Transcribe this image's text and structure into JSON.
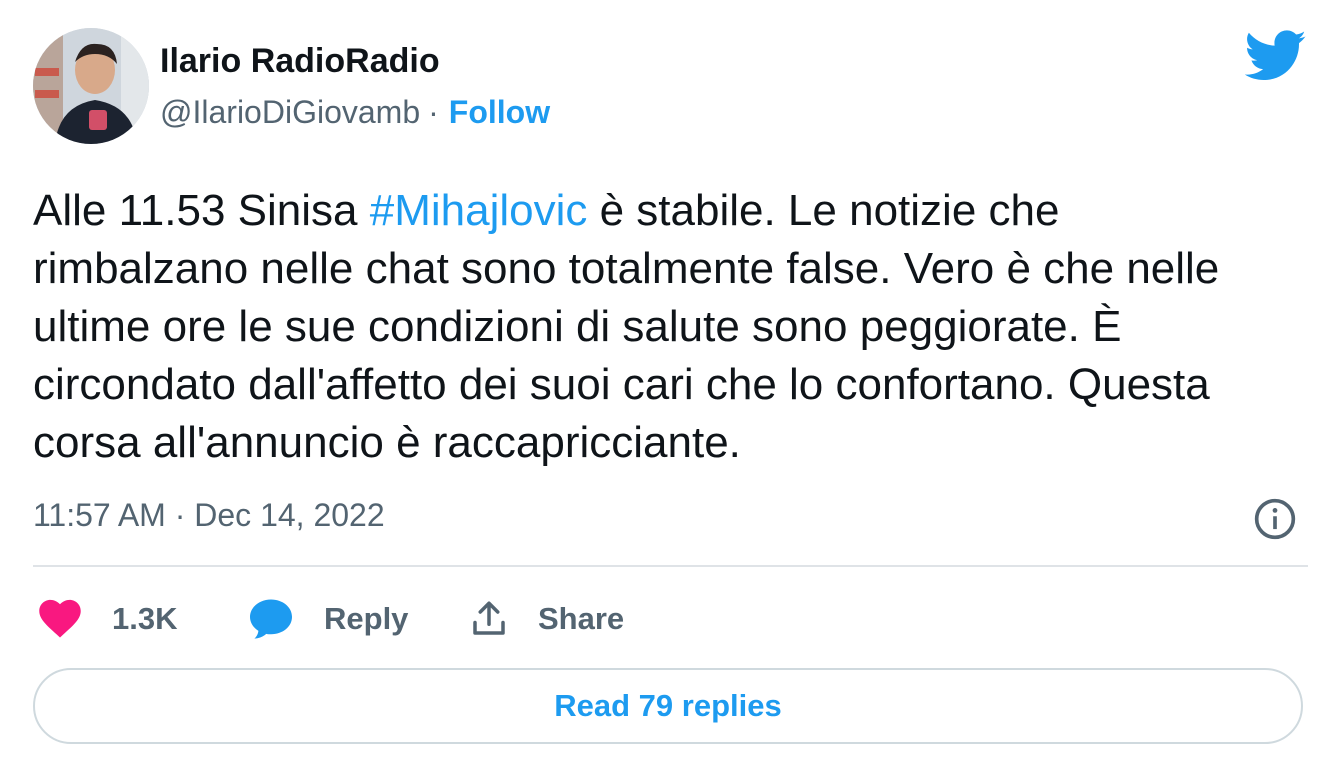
{
  "author": {
    "display_name": "Ilario RadioRadio",
    "handle": "@IlarioDiGiovamb",
    "separator": "·",
    "follow_label": "Follow"
  },
  "tweet": {
    "text_before_hashtag": "Alle 11.53 Sinisa ",
    "hashtag": "#Mihajlovic",
    "text_after_hashtag": " è stabile. Le notizie che rimbalzano nelle chat sono totalmente false. Vero è che nelle ultime ore le sue condizioni di salute sono peggiorate. È circondato dall'affetto dei suoi cari che lo confortano. Questa corsa all'annuncio è raccapricciante.",
    "timestamp": "11:57 AM · Dec 14, 2022"
  },
  "actions": {
    "like_count": "1.3K",
    "reply_label": "Reply",
    "share_label": "Share",
    "read_replies_label": "Read 79 replies"
  },
  "icons": {
    "brand": "twitter-bird-icon",
    "like": "heart-icon",
    "reply": "speech-bubble-icon",
    "share": "share-upload-icon",
    "info": "info-icon"
  },
  "colors": {
    "accent": "#1d9bf0",
    "like": "#f91880",
    "muted_text": "#536471",
    "primary_text": "#0f1419",
    "divider": "#dfe3e7"
  }
}
